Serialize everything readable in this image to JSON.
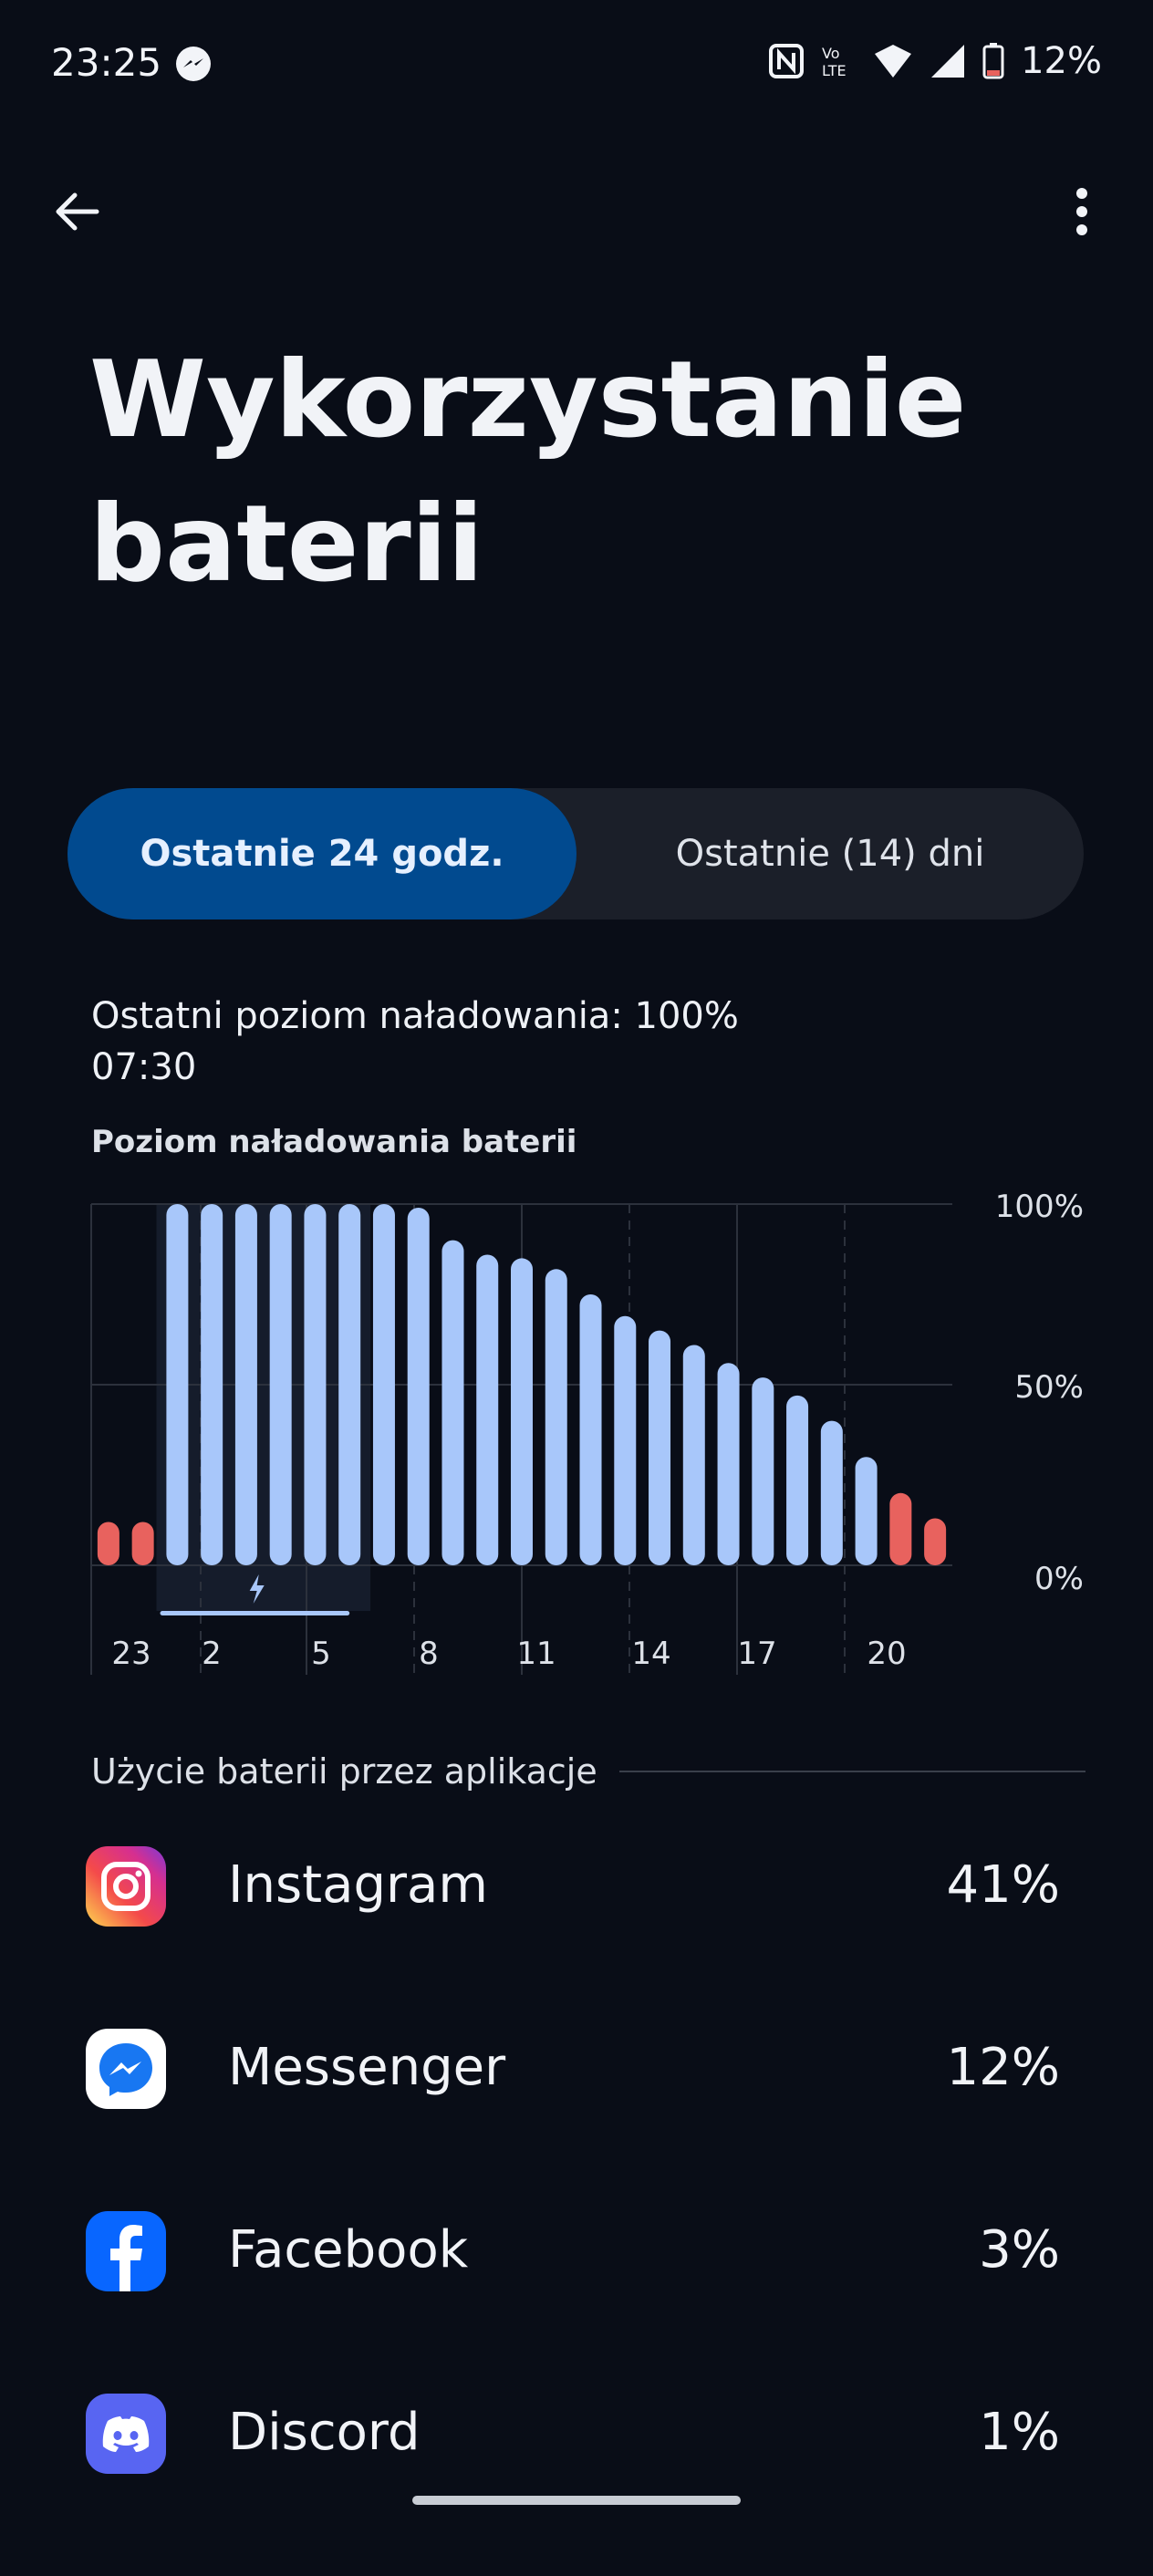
{
  "status_bar": {
    "time": "23:25",
    "battery_text": "12%",
    "icons": [
      "messenger-icon",
      "nfc-icon",
      "volte-icon",
      "wifi-icon",
      "signal-icon",
      "battery-icon"
    ]
  },
  "toolbar": {
    "back_icon": "arrow-left-icon",
    "more_icon": "more-vert-icon"
  },
  "page": {
    "title_line1": "Wykorzystanie",
    "title_line2": "baterii"
  },
  "tabs": [
    {
      "label": "Ostatnie 24 godz.",
      "active": true
    },
    {
      "label": "Ostatnie (14) dni",
      "active": false
    }
  ],
  "last_charge": {
    "label": "Ostatni poziom naładowania: 100%",
    "time": "07:30"
  },
  "chart_data": {
    "type": "bar",
    "title": "Poziom naładowania baterii",
    "x_tick_labels": [
      "23",
      "2",
      "5",
      "8",
      "11",
      "14",
      "17",
      "20"
    ],
    "y_tick_labels": [
      "100%",
      "50%",
      "0%"
    ],
    "ylim": [
      0,
      100
    ],
    "values": [
      12,
      12,
      100,
      100,
      100,
      100,
      100,
      100,
      100,
      99,
      90,
      86,
      85,
      82,
      75,
      69,
      65,
      61,
      56,
      52,
      47,
      40,
      30,
      20,
      13
    ],
    "low_threshold": 20,
    "colors": {
      "normal": "#a8c7fa",
      "low": "#e8625e"
    },
    "charging_icon": "bolt-icon",
    "grid": true
  },
  "apps_section": {
    "title": "Użycie baterii przez aplikacje",
    "apps": [
      {
        "name": "Instagram",
        "percent": "41%",
        "icon": "instagram-icon"
      },
      {
        "name": "Messenger",
        "percent": "12%",
        "icon": "messenger-app-icon"
      },
      {
        "name": "Facebook",
        "percent": "3%",
        "icon": "facebook-icon"
      },
      {
        "name": "Discord",
        "percent": "1%",
        "icon": "discord-icon"
      }
    ]
  }
}
